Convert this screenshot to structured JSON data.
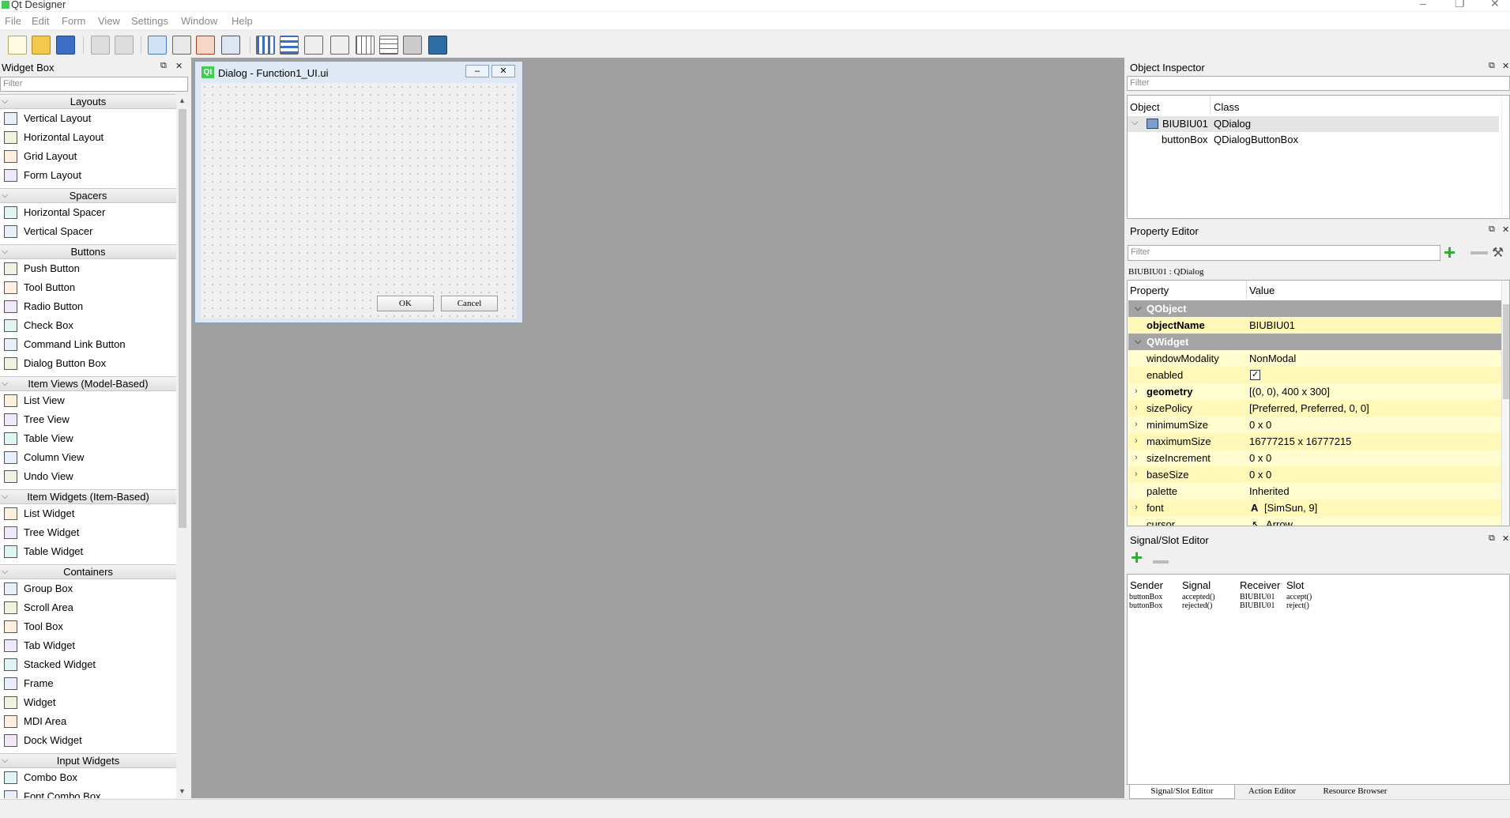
{
  "window": {
    "title": "Qt Designer"
  },
  "menu": [
    "File",
    "Edit",
    "Form",
    "View",
    "Settings",
    "Window",
    "Help"
  ],
  "widget_box": {
    "title": "Widget Box",
    "filter_placeholder": "Filter",
    "categories": [
      {
        "label": "Layouts",
        "items": [
          "Vertical Layout",
          "Horizontal Layout",
          "Grid Layout",
          "Form Layout"
        ]
      },
      {
        "label": "Spacers",
        "items": [
          "Horizontal Spacer",
          "Vertical Spacer"
        ]
      },
      {
        "label": "Buttons",
        "items": [
          "Push Button",
          "Tool Button",
          "Radio Button",
          "Check Box",
          "Command Link Button",
          "Dialog Button Box"
        ]
      },
      {
        "label": "Item Views (Model-Based)",
        "items": [
          "List View",
          "Tree View",
          "Table View",
          "Column View",
          "Undo View"
        ]
      },
      {
        "label": "Item Widgets (Item-Based)",
        "items": [
          "List Widget",
          "Tree Widget",
          "Table Widget"
        ]
      },
      {
        "label": "Containers",
        "items": [
          "Group Box",
          "Scroll Area",
          "Tool Box",
          "Tab Widget",
          "Stacked Widget",
          "Frame",
          "Widget",
          "MDI Area",
          "Dock Widget"
        ]
      },
      {
        "label": "Input Widgets",
        "items": [
          "Combo Box",
          "Font Combo Box"
        ]
      }
    ]
  },
  "dialog": {
    "title": "Dialog - Function1_UI.ui",
    "ok_label": "OK",
    "cancel_label": "Cancel"
  },
  "object_inspector": {
    "title": "Object Inspector",
    "filter_placeholder": "Filter",
    "col_object": "Object",
    "col_class": "Class",
    "rows": [
      {
        "object": "BIUBIU01",
        "class": "QDialog"
      },
      {
        "object": "buttonBox",
        "class": "QDialogButtonBox"
      }
    ]
  },
  "property_editor": {
    "title": "Property Editor",
    "filter_placeholder": "Filter",
    "context": "BIUBIU01 : QDialog",
    "col_property": "Property",
    "col_value": "Value",
    "section_qobject": "QObject",
    "section_qwidget": "QWidget",
    "object_name": {
      "name": "objectName",
      "value": "BIUBIU01"
    },
    "props": [
      {
        "name": "windowModality",
        "value": "NonModal"
      },
      {
        "name": "enabled",
        "value": ""
      },
      {
        "name": "geometry",
        "value": "[(0, 0), 400 x 300]"
      },
      {
        "name": "sizePolicy",
        "value": "[Preferred, Preferred, 0, 0]"
      },
      {
        "name": "minimumSize",
        "value": "0 x 0"
      },
      {
        "name": "maximumSize",
        "value": "16777215 x 16777215"
      },
      {
        "name": "sizeIncrement",
        "value": "0 x 0"
      },
      {
        "name": "baseSize",
        "value": "0 x 0"
      },
      {
        "name": "palette",
        "value": "Inherited"
      },
      {
        "name": "font",
        "value": "[SimSun, 9]"
      },
      {
        "name": "cursor",
        "value": "Arrow"
      }
    ],
    "enabled_checked": true
  },
  "signal_slot": {
    "title": "Signal/Slot Editor",
    "col_sender": "Sender",
    "col_signal": "Signal",
    "col_receiver": "Receiver",
    "col_slot": "Slot",
    "rows": [
      {
        "sender": "buttonBox",
        "signal": "accepted()",
        "receiver": "BIUBIU01",
        "slot": "accept()"
      },
      {
        "sender": "buttonBox",
        "signal": "rejected()",
        "receiver": "BIUBIU01",
        "slot": "reject()"
      }
    ],
    "tabs": [
      "Signal/Slot Editor",
      "Action Editor",
      "Resource Browser"
    ]
  }
}
